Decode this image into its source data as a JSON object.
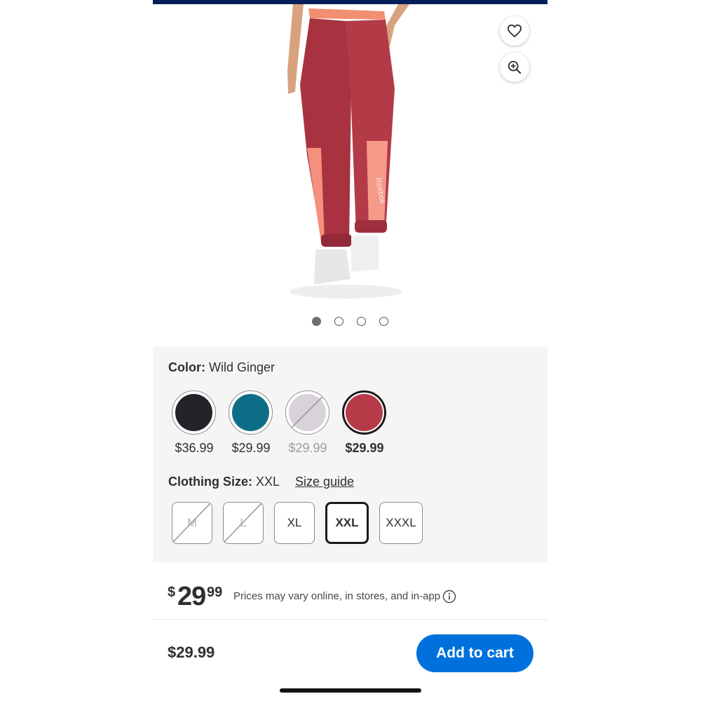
{
  "colors": {
    "brand_navy": "#041e5b",
    "accent_blue": "#0071dc",
    "panel_bg": "#f5f5f6"
  },
  "gallery": {
    "image_alt": "Reebok woven jogger pants, Wild Ginger",
    "garment_print": "Reebok",
    "dots": [
      {
        "active": true
      },
      {
        "active": false
      },
      {
        "active": false
      },
      {
        "active": false
      }
    ],
    "favorite_icon": "heart-icon",
    "zoom_icon": "zoom-in-icon"
  },
  "color_option": {
    "label": "Color:",
    "value": "Wild Ginger",
    "swatches": [
      {
        "hex": "#23232a",
        "price": "$36.99",
        "available": true,
        "selected": false
      },
      {
        "hex": "#0f6e87",
        "price": "$29.99",
        "available": true,
        "selected": false
      },
      {
        "hex": "#d8cfd8",
        "price": "$29.99",
        "available": false,
        "selected": false
      },
      {
        "hex": "#b63a47",
        "price": "$29.99",
        "available": true,
        "selected": true
      }
    ]
  },
  "size_option": {
    "label": "Clothing Size:",
    "value": "XXL",
    "guide_link": "Size guide",
    "sizes": [
      {
        "label": "M",
        "available": false,
        "selected": false
      },
      {
        "label": "L",
        "available": false,
        "selected": false
      },
      {
        "label": "XL",
        "available": true,
        "selected": false
      },
      {
        "label": "XXL",
        "available": true,
        "selected": true
      },
      {
        "label": "XXXL",
        "available": true,
        "selected": false
      }
    ]
  },
  "price": {
    "currency": "$",
    "whole": "29",
    "cents": "99",
    "note": "Prices may vary online, in stores, and in-app",
    "info_icon": "info-icon"
  },
  "footer": {
    "price": "$29.99",
    "add_to_cart": "Add to cart"
  }
}
